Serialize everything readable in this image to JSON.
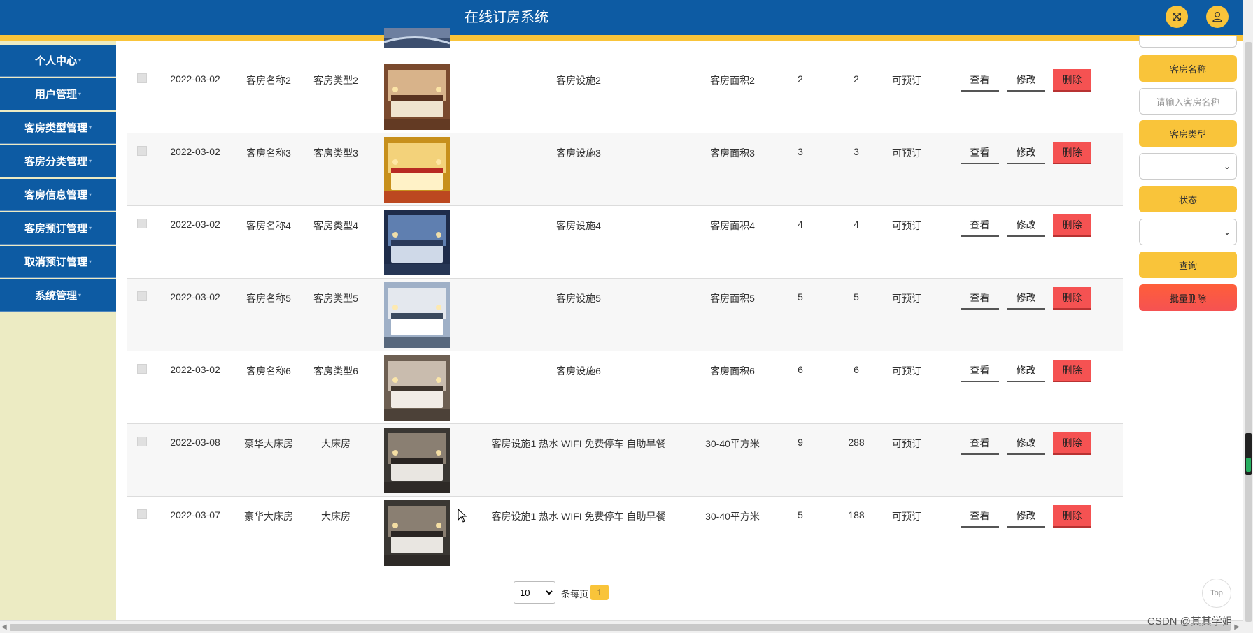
{
  "app": {
    "title": "在线订房系统"
  },
  "header": {
    "fullscreen_icon": "expand-icon",
    "user_icon": "user-icon"
  },
  "sidebar": {
    "items": [
      {
        "label": "个人中心"
      },
      {
        "label": "用户管理"
      },
      {
        "label": "客房类型管理"
      },
      {
        "label": "客房分类管理"
      },
      {
        "label": "客房信息管理"
      },
      {
        "label": "客房预订管理"
      },
      {
        "label": "取消预订管理"
      },
      {
        "label": "系统管理"
      }
    ]
  },
  "rows": [
    {
      "date": "2022-03-02",
      "name": "客房名称2",
      "type": "客房类型2",
      "facility": "客房设施2",
      "area": "客房面积2",
      "col_a": "2",
      "col_b": "2",
      "status": "可预订",
      "image": "hotel-room-photo"
    },
    {
      "date": "2022-03-02",
      "name": "客房名称3",
      "type": "客房类型3",
      "facility": "客房设施3",
      "area": "客房面积3",
      "col_a": "3",
      "col_b": "3",
      "status": "可预订",
      "image": "hotel-room-photo"
    },
    {
      "date": "2022-03-02",
      "name": "客房名称4",
      "type": "客房类型4",
      "facility": "客房设施4",
      "area": "客房面积4",
      "col_a": "4",
      "col_b": "4",
      "status": "可预订",
      "image": "hotel-room-photo"
    },
    {
      "date": "2022-03-02",
      "name": "客房名称5",
      "type": "客房类型5",
      "facility": "客房设施5",
      "area": "客房面积5",
      "col_a": "5",
      "col_b": "5",
      "status": "可预订",
      "image": "hotel-room-photo"
    },
    {
      "date": "2022-03-02",
      "name": "客房名称6",
      "type": "客房类型6",
      "facility": "客房设施6",
      "area": "客房面积6",
      "col_a": "6",
      "col_b": "6",
      "status": "可预订",
      "image": "hotel-room-photo"
    },
    {
      "date": "2022-03-08",
      "name": "豪华大床房",
      "type": "大床房",
      "facility": "客房设施1 热水 WIFI 免费停车 自助早餐",
      "area": "30-40平方米",
      "col_a": "9",
      "col_b": "288",
      "status": "可预订",
      "image": "hotel-room-photo"
    },
    {
      "date": "2022-03-07",
      "name": "豪华大床房",
      "type": "大床房",
      "facility": "客房设施1 热水 WIFI 免费停车 自助早餐",
      "area": "30-40平方米",
      "col_a": "5",
      "col_b": "188",
      "status": "可预订",
      "image": "hotel-room-photo"
    }
  ],
  "actions": {
    "view": "查看",
    "edit": "修改",
    "delete": "删除"
  },
  "pagination": {
    "page_size": "10",
    "per_page_label": "条每页",
    "current_page": "1"
  },
  "search_panel": {
    "room_name_label": "客房名称",
    "room_name_placeholder": "请输入客房名称",
    "room_type_label": "客房类型",
    "room_type_value": "",
    "status_label": "状态",
    "status_value": "",
    "search_button": "查询",
    "batch_delete_button": "批量删除"
  },
  "back_to_top": "Top",
  "watermark": "CSDN @其其学姐",
  "colors": {
    "primary_blue": "#0d5ba3",
    "accent_yellow": "#f9c43a",
    "danger_red": "#f55252",
    "sidebar_bg": "#ecebc3"
  }
}
